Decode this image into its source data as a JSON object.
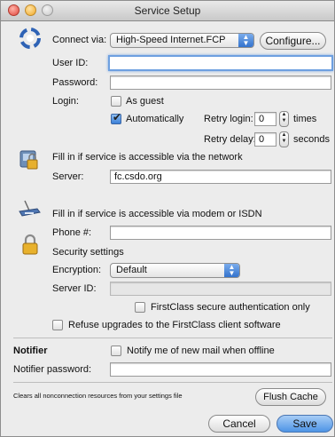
{
  "window": {
    "title": "Service Setup"
  },
  "connect": {
    "label": "Connect via:",
    "selected": "High-Speed Internet.FCP",
    "configure_label": "Configure..."
  },
  "user_id": {
    "label": "User ID:",
    "value": ""
  },
  "password": {
    "label": "Password:",
    "value": ""
  },
  "login": {
    "label": "Login:",
    "as_guest_label": "As guest",
    "automatically_label": "Automatically",
    "retry_login_label": "Retry login:",
    "retry_login_value": "0",
    "times_label": "times",
    "retry_delay_label": "Retry delay:",
    "retry_delay_value": "0",
    "seconds_label": "seconds"
  },
  "network": {
    "heading": "Fill in if service is accessible via the network",
    "server_label": "Server:",
    "server_value": "fc.csdo.org"
  },
  "modem": {
    "heading": "Fill in if service is accessible via modem or ISDN",
    "phone_label": "Phone #:",
    "phone_value": ""
  },
  "security": {
    "heading": "Security settings",
    "encryption_label": "Encryption:",
    "encryption_selected": "Default",
    "server_id_label": "Server ID:",
    "server_id_value": "",
    "secure_auth_label": "FirstClass secure authentication only",
    "refuse_upgrades_label": "Refuse upgrades to the FirstClass client software"
  },
  "notifier": {
    "heading": "Notifier",
    "notify_label": "Notify me of new mail when offline",
    "password_label": "Notifier password:",
    "password_value": ""
  },
  "cache": {
    "description": "Clears all nonconnection resources from your settings file",
    "flush_label": "Flush Cache"
  },
  "footer": {
    "cancel_label": "Cancel",
    "save_label": "Save"
  },
  "colors": {
    "focus_ring": "#6ea0e0",
    "default_button": "#4e94e6",
    "window_bg": "#ececec"
  }
}
